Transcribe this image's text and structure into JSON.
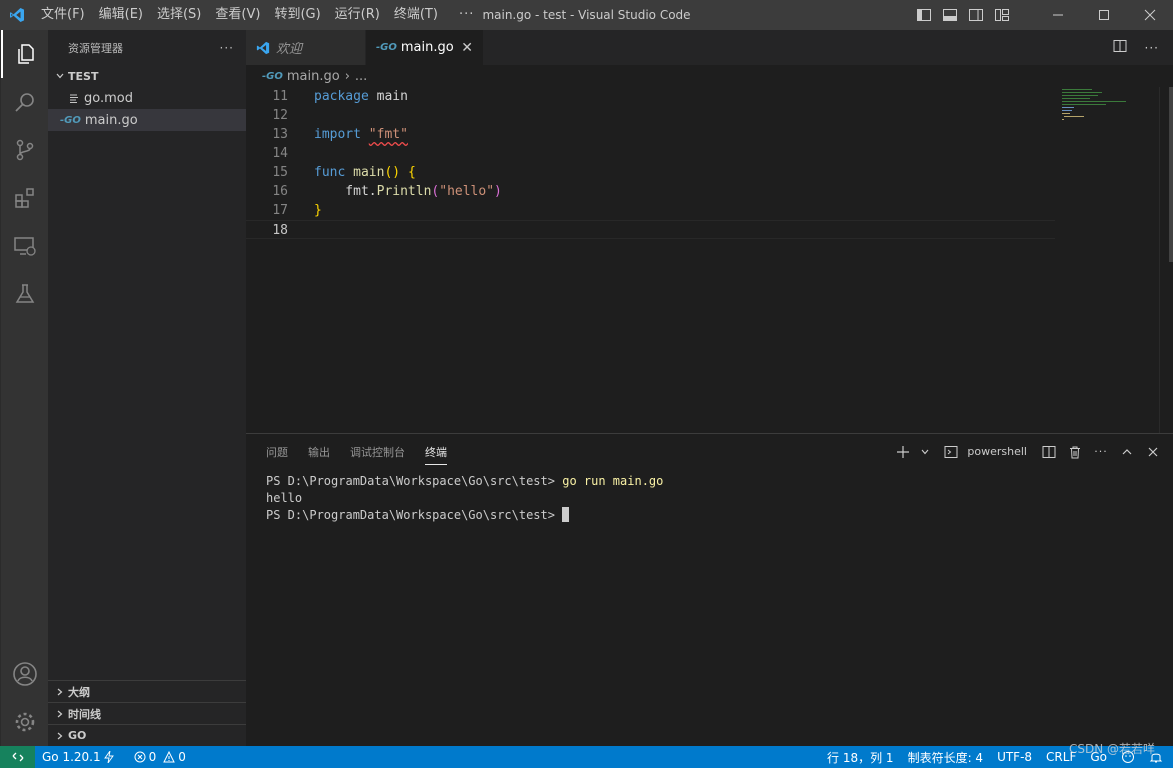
{
  "titlebar": {
    "menu": [
      "文件(F)",
      "编辑(E)",
      "选择(S)",
      "查看(V)",
      "转到(G)",
      "运行(R)",
      "终端(T)",
      "···"
    ],
    "title": "main.go - test - Visual Studio Code",
    "logo_icon": "vscode-logo-icon"
  },
  "sidebar": {
    "header": "资源管理器",
    "more": "···",
    "folder": "TEST",
    "files": [
      {
        "name": "go.mod",
        "icon": "lines-icon"
      },
      {
        "name": "main.go",
        "icon_text": "-GO"
      }
    ],
    "sections": [
      "大纲",
      "时间线",
      "GO"
    ]
  },
  "tabs": [
    {
      "label": "欢迎",
      "active": false
    },
    {
      "label": "main.go",
      "icon_text": "-GO",
      "active": true,
      "close": "✕"
    }
  ],
  "breadcrumb": {
    "icon_text": "-GO",
    "file": "main.go",
    "sep": "›",
    "rest": "..."
  },
  "editor": {
    "lines": [
      {
        "num": "11"
      },
      {
        "num": "12"
      },
      {
        "num": "13"
      },
      {
        "num": "14"
      },
      {
        "num": "15"
      },
      {
        "num": "16"
      },
      {
        "num": "17"
      },
      {
        "num": "18"
      }
    ],
    "code": {
      "l11_kw": "package",
      "l11_rest": " main",
      "l13_kw": "import",
      "l13_str": "\"fmt\"",
      "l15_kw": "func",
      "l15_fn": "main",
      "l15_paren": "()",
      "l15_brace": "{",
      "l16_pkg": "    fmt.",
      "l16_fn": "Println",
      "l16_open": "(",
      "l16_str": "\"hello\"",
      "l16_close": ")",
      "l17_brace": "}"
    }
  },
  "panel": {
    "tabs": [
      "问题",
      "输出",
      "调试控制台",
      "终端"
    ],
    "active_tab": "终端",
    "shell": "powershell",
    "terminal": {
      "prompt1": "PS D:\\ProgramData\\Workspace\\Go\\src\\test> ",
      "cmd1": "go run main.go",
      "output": "hello",
      "prompt2": "PS D:\\ProgramData\\Workspace\\Go\\src\\test> "
    }
  },
  "statusbar": {
    "go_version": "Go 1.20.1",
    "errors": "0",
    "warnings": "0",
    "position": "行 18，列 1",
    "tab_size": "制表符长度: 4",
    "encoding": "UTF-8",
    "eol": "CRLF",
    "language": "Go"
  },
  "watermark": "CSDN @若若咩",
  "colors": {
    "accent": "#007acc",
    "remote": "#16825d"
  }
}
